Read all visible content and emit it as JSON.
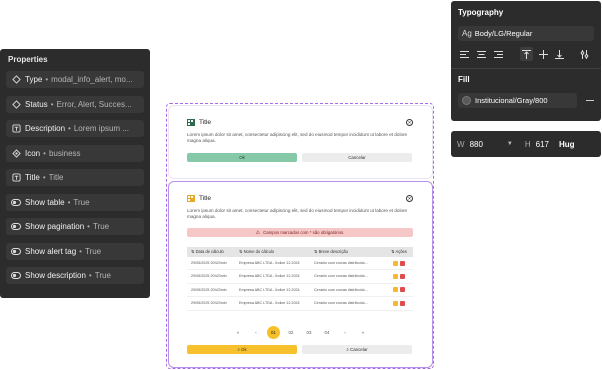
{
  "properties": {
    "title": "Properties",
    "rows": [
      {
        "icon": "diamond-icon",
        "name": "Type",
        "value": "modal_info_alert, mo..."
      },
      {
        "icon": "diamond-icon",
        "name": "Status",
        "value": "Error, Alert, Succes..."
      },
      {
        "icon": "text-icon",
        "name": "Description",
        "value": "Lorem ipsum ..."
      },
      {
        "icon": "component-icon",
        "name": "Icon",
        "value": "business"
      },
      {
        "icon": "text-icon",
        "name": "Title",
        "value": "Title"
      },
      {
        "icon": "toggle-icon",
        "name": "Show table",
        "value": "True"
      },
      {
        "icon": "toggle-icon",
        "name": "Show pagination",
        "value": "True"
      },
      {
        "icon": "toggle-icon",
        "name": "Show alert tag",
        "value": "True"
      },
      {
        "icon": "toggle-icon",
        "name": "Show description",
        "value": "True"
      }
    ]
  },
  "typography": {
    "title": "Typography",
    "glyph": "Ag",
    "style": "Body/LG/Regular",
    "fill_title": "Fill",
    "fill_value": "Institucional/Gray/800"
  },
  "dimensions": {
    "w_label": "W",
    "w_value": "880",
    "h_label": "H",
    "h_value": "617",
    "hug": "Hug"
  },
  "modal_small": {
    "title": "Title",
    "description": "Lorem ipsum dolor sit amet, consectetur adipiscing elit, sed do eiusmod tempor incididunt ut labore et dolore magna aliqua.",
    "ok": "Ok",
    "cancel": "Cancelar"
  },
  "modal_large": {
    "title": "Title",
    "description": "Lorem ipsum dolor sit amet, consectetur adipiscing elit, sed do eiusmod tempor incididunt ut labore et dolore magna aliqua.",
    "alert": "Campos marcados com * são obrigatórios.",
    "columns": [
      "Data de cálculo",
      "Nome do cálculo",
      "Breve descrição",
      "Ações"
    ],
    "rows": [
      [
        "29/05/2025 20h23min",
        "Empresa ABC LTDA - Índice 12.2024",
        "Cenário com curvas distribuído..."
      ],
      [
        "29/05/2025 20h23min",
        "Empresa ABC LTDA - Índice 12.2024",
        "Cenário com curvas distribuído..."
      ],
      [
        "29/05/2025 20h23min",
        "Empresa ABC LTDA - Índice 12.2024",
        "Cenário com curvas distribuído..."
      ],
      [
        "29/05/2025 20h23min",
        "Empresa ABC LTDA - Índice 12.2024",
        "Cenário com curvas distribuído..."
      ]
    ],
    "pagination": [
      "«",
      "‹",
      "01",
      "02",
      "03",
      "04",
      "›",
      "»"
    ],
    "active_page": "01",
    "ok": "Ok",
    "cancel": "Cancelar"
  },
  "colors": {
    "panel_bg": "#2c2c2c",
    "frame_border": "#a86ce6",
    "ok_green": "#85c9a9",
    "ok_yellow": "#f7c12d",
    "alert_bg": "#f6c7c7"
  }
}
